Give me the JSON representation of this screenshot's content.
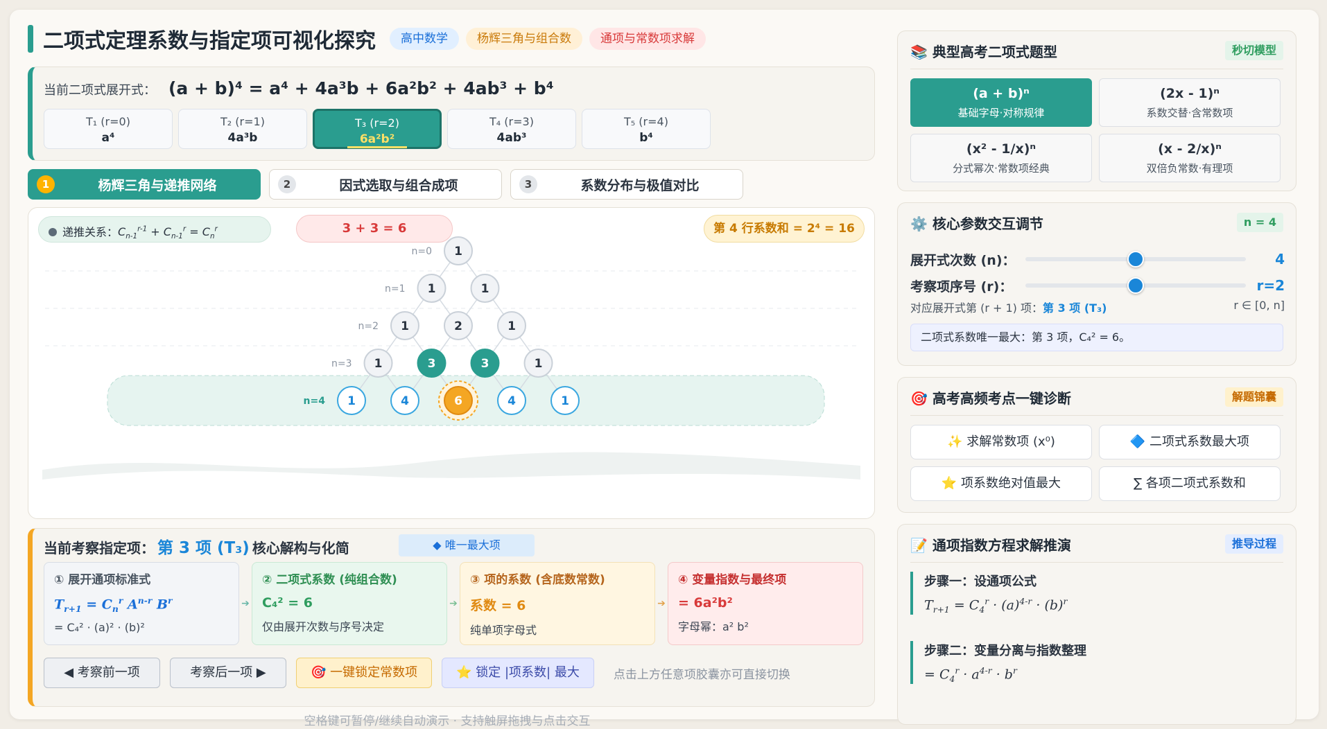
{
  "header": {
    "title": "二项式定理系数与指定项可视化探究",
    "tags": [
      "高中数学",
      "杨辉三角与组合数",
      "通项与常数项求解"
    ]
  },
  "expansion": {
    "label": "当前二项式展开式：",
    "formula": "(a + b)⁴ = a⁴ + 4a³b + 6a²b² + 4ab³ + b⁴",
    "terms": [
      {
        "name": "T₁ (r=0)",
        "value": "a⁴"
      },
      {
        "name": "T₂ (r=1)",
        "value": "4a³b"
      },
      {
        "name": "T₃ (r=2)",
        "value": "6a²b²"
      },
      {
        "name": "T₄ (r=3)",
        "value": "4ab³"
      },
      {
        "name": "T₅ (r=4)",
        "value": "b⁴"
      }
    ],
    "active_index": 2
  },
  "steps": [
    {
      "num": "1",
      "label": "杨辉三角与递推网络"
    },
    {
      "num": "2",
      "label": "因式选取与组合成项"
    },
    {
      "num": "3",
      "label": "系数分布与极值对比"
    }
  ],
  "triangle": {
    "recurrence_prefix": "递推关系：",
    "recurrence": "Cn-1r-1 + Cn-1r = Cnr",
    "sum_hint": "3 + 3 = 6",
    "row_sum": "第 4 行系数和 = 2⁴ = 16",
    "rows": [
      {
        "label": "n=0",
        "values": [
          "1"
        ]
      },
      {
        "label": "n=1",
        "values": [
          "1",
          "1"
        ]
      },
      {
        "label": "n=2",
        "values": [
          "1",
          "2",
          "1"
        ]
      },
      {
        "label": "n=3",
        "values": [
          "1",
          "3",
          "3",
          "1"
        ]
      },
      {
        "label": "n=4",
        "values": [
          "1",
          "4",
          "6",
          "4",
          "1"
        ]
      }
    ],
    "highlight": {
      "row": 4,
      "index": 2,
      "parents": [
        1,
        2
      ]
    },
    "colors": {
      "teal": "#2a9d8f",
      "orange": "#f4a623",
      "blue": "#3aa7e0"
    }
  },
  "analysis": {
    "title_prefix": "当前考察指定项：",
    "title_term": "第 3 项 (T₃)",
    "title_suffix": "核心解构与化简",
    "badge": "◆ 唯一最大项",
    "boxes": [
      {
        "head": "① 展开通项标准式",
        "main": "Tr+1 = Cnr An-r Br",
        "sub": "= C₄² · (a)² · (b)²"
      },
      {
        "head": "② 二项式系数 (纯组合数)",
        "main": "C₄² = 6",
        "sub": "仅由展开次数与序号决定"
      },
      {
        "head": "③ 项的系数 (含底数常数)",
        "main": "系数 = 6",
        "sub": "纯单项字母式"
      },
      {
        "head": "④ 变量指数与最终项",
        "main": "= 6a²b²",
        "sub": "字母幂：a² b²"
      }
    ],
    "buttons": {
      "prev": "◀ 考察前一项",
      "next": "考察后一项 ▶",
      "lock_const": "🎯 一键锁定常数项",
      "lock_max": "⭐ 锁定 |项系数| 最大"
    },
    "hint": "点击上方任意项胶囊亦可直接切换"
  },
  "footer": "空格键可暂停/继续自动演示 · 支持触屏拖拽与点击交互",
  "sidebar": {
    "questions": {
      "title": "📚 典型高考二项式题型",
      "tag": "秒切模型",
      "items": [
        {
          "expr": "(a + b)ⁿ",
          "desc": "基础字母·对称规律"
        },
        {
          "expr": "(2x - 1)ⁿ",
          "desc": "系数交替·含常数项"
        },
        {
          "expr": "(x² - 1/x)ⁿ",
          "desc": "分式幂次·常数项经典"
        },
        {
          "expr": "(x - 2/x)ⁿ",
          "desc": "双倍负常数·有理项"
        }
      ],
      "active_index": 0
    },
    "params": {
      "title": "⚙️ 核心参数交互调节",
      "tag": "n = 4",
      "n_label": "展开式次数 (n)：",
      "n_value": "4",
      "n_fraction": 0.5,
      "r_label": "考察项序号 (r)：",
      "r_value": "r=2",
      "r_fraction": 0.5,
      "corr_prefix": "对应展开式第 (r + 1) 项：",
      "corr_term": "第 3 项 (T₃)",
      "range": "r ∈ [0, n]",
      "max_info": "二项式系数唯一最大：第 3 项，C₄² = 6。"
    },
    "diagnosis": {
      "title": "🎯 高考高频考点一键诊断",
      "tag": "解题锦囊",
      "buttons": [
        "✨ 求解常数项 (x⁰)",
        "🔷 二项式系数最大项",
        "⭐ 项系数绝对值最大",
        "∑ 各项二项式系数和"
      ]
    },
    "derivation": {
      "title": "📝 通项指数方程求解推演",
      "tag": "推导过程",
      "step1_title": "步骤一：设通项公式",
      "step1_formula": "Tr+1 = C4r · (a)4-r · (b)r",
      "step2_title": "步骤二：变量分离与指数整理",
      "step2_formula": "= C4r · a4-r · br"
    }
  }
}
